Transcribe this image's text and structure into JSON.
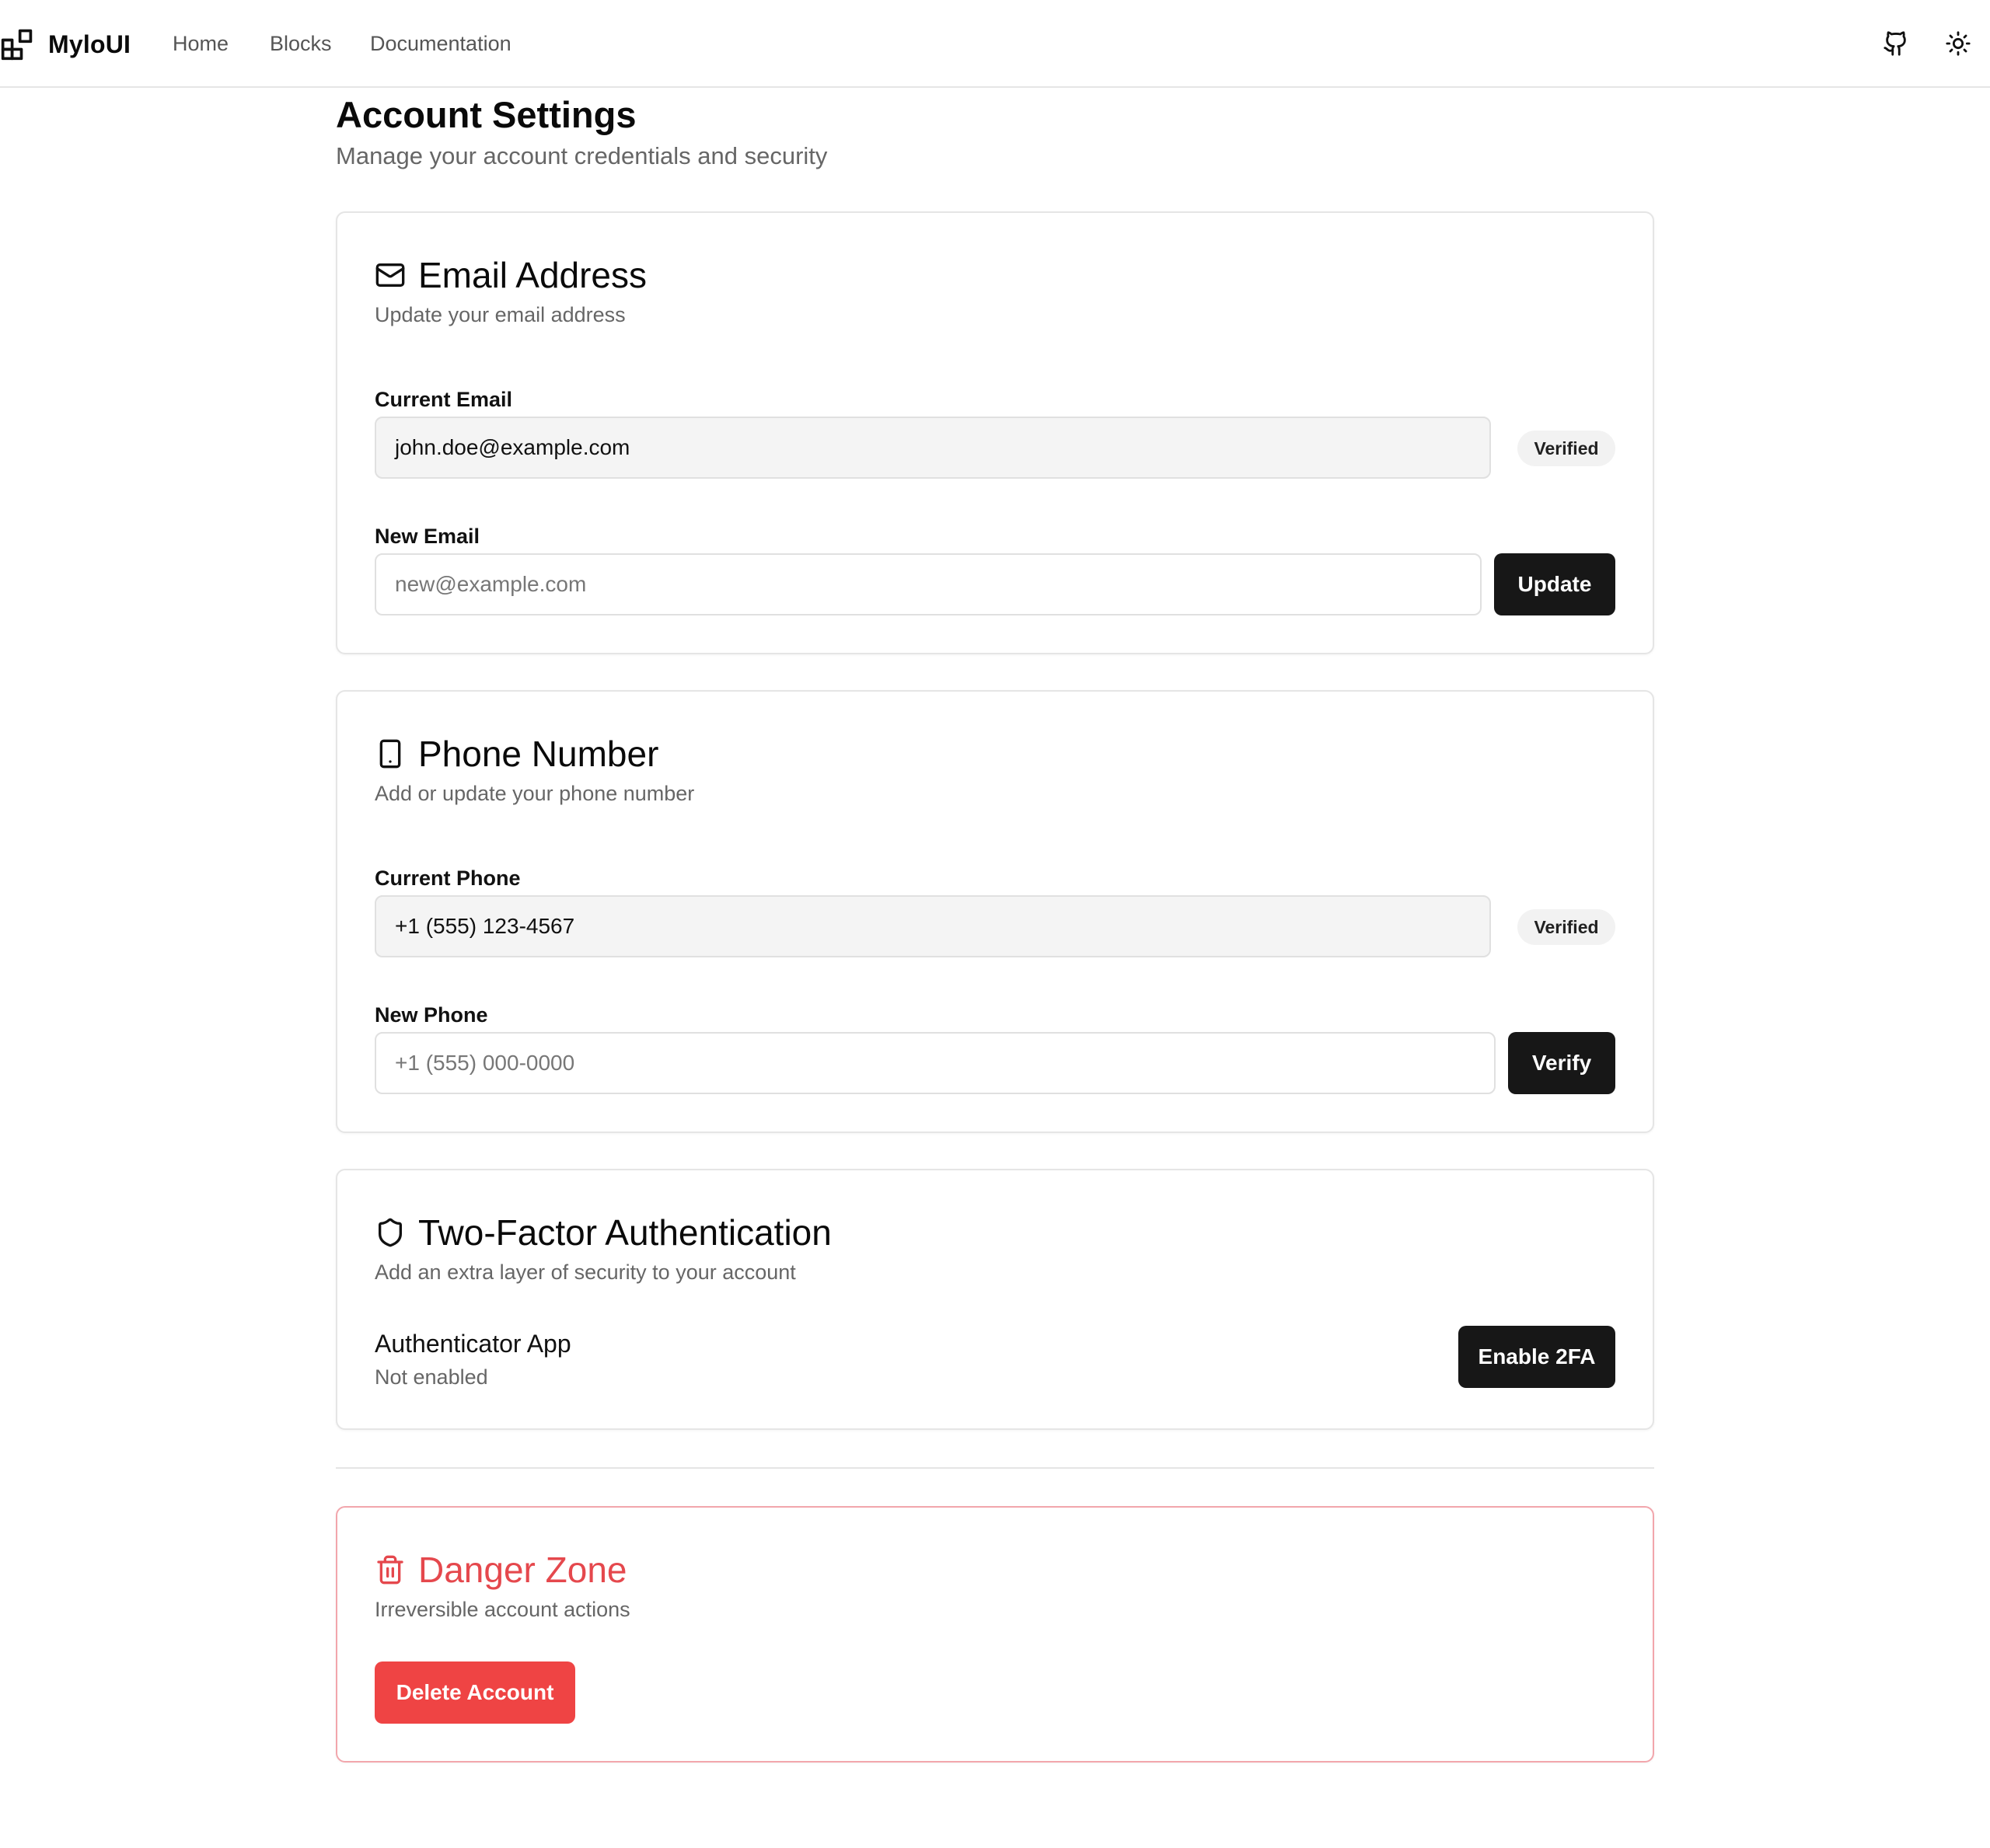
{
  "header": {
    "brand": "MyloUI",
    "nav": [
      "Home",
      "Blocks",
      "Documentation"
    ],
    "icons": [
      "github-icon",
      "sun-icon"
    ]
  },
  "page": {
    "title": "Account Settings",
    "subtitle": "Manage your account credentials and security"
  },
  "email": {
    "title": "Email Address",
    "description": "Update your email address",
    "current_label": "Current Email",
    "current_value": "john.doe@example.com",
    "badge": "Verified",
    "new_label": "New Email",
    "new_placeholder": "new@example.com",
    "button": "Update",
    "icon": "mail-icon"
  },
  "phone": {
    "title": "Phone Number",
    "description": "Add or update your phone number",
    "current_label": "Current Phone",
    "current_value": "+1 (555) 123-4567",
    "badge": "Verified",
    "new_label": "New Phone",
    "new_placeholder": "+1 (555) 000-0000",
    "button": "Verify",
    "icon": "smartphone-icon"
  },
  "twofa": {
    "title": "Two-Factor Authentication",
    "description": "Add an extra layer of security to your account",
    "app_label": "Authenticator App",
    "status": "Not enabled",
    "button": "Enable 2FA",
    "icon": "shield-icon"
  },
  "danger": {
    "title": "Danger Zone",
    "description": "Irreversible account actions",
    "button": "Delete Account",
    "icon": "trash-icon",
    "color": "#e5484d"
  },
  "colors": {
    "primary_button": "#171717",
    "danger_button": "#ef4444",
    "border": "#e5e5e5",
    "muted_text": "#666666"
  }
}
